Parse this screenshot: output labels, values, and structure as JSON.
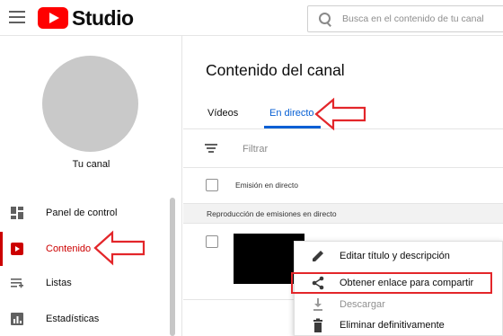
{
  "header": {
    "menu_icon": "hamburger-menu-icon",
    "logo_text": "Studio",
    "search_placeholder": "Busca en el contenido de tu canal"
  },
  "sidebar": {
    "channel_label": "Tu canal",
    "items": [
      {
        "label": "Panel de control",
        "icon": "dashboard-icon",
        "active": false
      },
      {
        "label": "Contenido",
        "icon": "content-icon",
        "active": true
      },
      {
        "label": "Listas",
        "icon": "playlist-icon",
        "active": false
      },
      {
        "label": "Estadísticas",
        "icon": "analytics-icon",
        "active": false
      }
    ]
  },
  "main": {
    "title": "Contenido del canal",
    "tabs": [
      {
        "label": "Vídeos",
        "active": false
      },
      {
        "label": "En directo",
        "active": true
      }
    ],
    "filter_label": "Filtrar",
    "table_header": "Emisión en directo",
    "section_label": "Reproducción de emisiones en directo"
  },
  "context_menu": {
    "items": [
      {
        "label": "Editar título y descripción",
        "icon": "pencil-icon",
        "disabled": false
      },
      {
        "label": "Obtener enlace para compartir",
        "icon": "share-icon",
        "disabled": false,
        "highlighted": true
      },
      {
        "label": "Descargar",
        "icon": "download-icon",
        "disabled": true
      },
      {
        "label": "Eliminar definitivamente",
        "icon": "trash-icon",
        "disabled": false
      }
    ]
  },
  "colors": {
    "brand_red": "#ff0000",
    "active_nav": "#cc0000",
    "active_tab": "#065fd4",
    "annotation_red": "#e3262a"
  }
}
